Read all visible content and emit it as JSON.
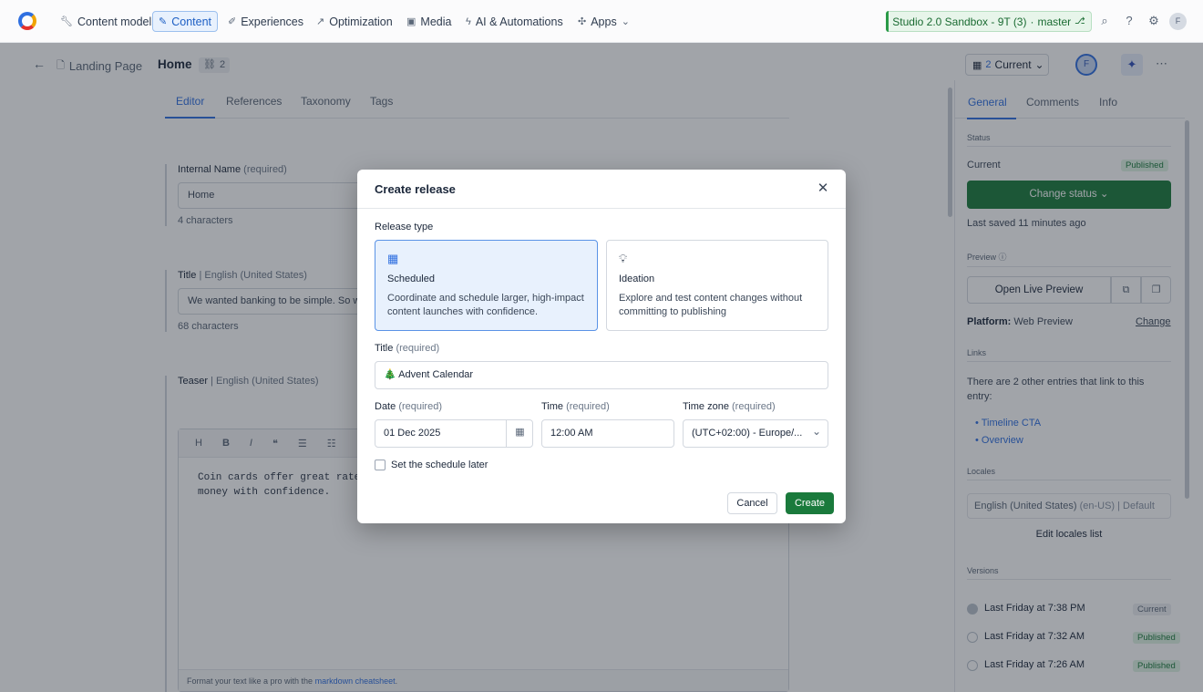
{
  "nav": {
    "items": [
      {
        "label": "Content model",
        "icon": "wrench-icon"
      },
      {
        "label": "Content",
        "icon": "pencil-icon"
      },
      {
        "label": "Experiences",
        "icon": "brush-icon"
      },
      {
        "label": "Optimization",
        "icon": "trend-icon"
      },
      {
        "label": "Media",
        "icon": "image-icon"
      },
      {
        "label": "AI & Automations",
        "icon": "bolt-icon"
      },
      {
        "label": "Apps",
        "icon": "puzzle-icon"
      }
    ],
    "environment": "Studio 2.0 Sandbox - 9T (3)",
    "branch": "master",
    "avatar_initial": "F"
  },
  "entry": {
    "content_type": "Landing Page",
    "title": "Home",
    "links_count": "2",
    "versions_count": "2",
    "version_label": "Current",
    "avatar_initial": "F",
    "tabs": [
      "Editor",
      "References",
      "Taxonomy",
      "Tags"
    ]
  },
  "fields": {
    "internal_name": {
      "label": "Internal Name",
      "req": "(required)",
      "value": "Home",
      "count": "4 characters"
    },
    "title": {
      "label": "Title",
      "locale": "English (United States)",
      "value": "We wanted banking to be simple. So w",
      "count": "68 characters"
    },
    "teaser": {
      "label": "Teaser",
      "locale": "English (United States)",
      "toolbar": [
        "H",
        "B",
        "I",
        "❝",
        "☰",
        "☷"
      ],
      "body": "Coin cards offer great rate\nmoney with confidence.",
      "footer_prefix": "Format your text like a pro with the",
      "footer_link": "markdown cheatsheet",
      "footer_suffix": "."
    }
  },
  "sidebar": {
    "tabs": [
      "General",
      "Comments",
      "Info"
    ],
    "status_section": "Status",
    "current_label": "Current",
    "published_badge": "Published",
    "change_status": "Change status",
    "last_saved": "Last saved 11 minutes ago",
    "preview_section": "Preview",
    "open_live_preview": "Open Live Preview",
    "platform_label": "Platform:",
    "platform_value": "Web Preview",
    "change_link": "Change",
    "links_section": "Links",
    "links_text": "There are 2 other entries that link to this entry:",
    "links": [
      "Timeline CTA",
      "Overview"
    ],
    "locales_section": "Locales",
    "locale_value": "English (United States)",
    "locale_code": "(en-US) | Default",
    "edit_locales": "Edit locales list",
    "versions_section": "Versions",
    "versions": [
      {
        "label": "Last Friday at 7:38 PM",
        "badge": "Current"
      },
      {
        "label": "Last Friday at 7:32 AM",
        "badge": "Published"
      },
      {
        "label": "Last Friday at 7:26 AM",
        "badge": "Published"
      }
    ]
  },
  "dialog": {
    "title": "Create release",
    "release_type_label": "Release type",
    "types": [
      {
        "name": "Scheduled",
        "desc": "Coordinate and schedule larger, high-impact content launches with confidence.",
        "selected": true
      },
      {
        "name": "Ideation",
        "desc": "Explore and test content changes without committing to publishing",
        "selected": false
      }
    ],
    "title_label": "Title",
    "required": "(required)",
    "title_value": "🎄 Advent Calendar",
    "date_label": "Date",
    "date_value": "01 Dec 2025",
    "time_label": "Time",
    "time_value": "12:00 AM",
    "timezone_label": "Time zone",
    "timezone_value": "(UTC+02:00) - Europe/...",
    "schedule_later": "Set the schedule later",
    "cancel": "Cancel",
    "create": "Create"
  },
  "colors": {
    "accent": "#2f6fe0",
    "primary_green": "#1a7a3c",
    "overlay": "rgba(30,38,50,0.42)"
  }
}
